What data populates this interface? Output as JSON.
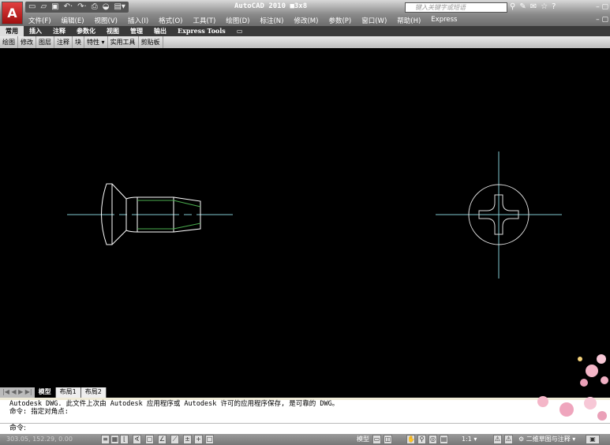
{
  "app": {
    "title": "AutoCAD 2010  ■3x8",
    "logo": "A"
  },
  "quick_access": [
    "new-icon",
    "open-icon",
    "save-icon",
    "undo-icon",
    "redo-icon",
    "plot-icon",
    "preview-icon",
    "workspace-icon"
  ],
  "search": {
    "placeholder": "键入关键字或短语"
  },
  "menu": [
    "文件(F)",
    "编辑(E)",
    "视图(V)",
    "插入(I)",
    "格式(O)",
    "工具(T)",
    "绘图(D)",
    "标注(N)",
    "修改(M)",
    "参数(P)",
    "窗口(W)",
    "帮助(H)",
    "Express"
  ],
  "ribbon_tabs": [
    "常用",
    "插入",
    "注释",
    "参数化",
    "视图",
    "管理",
    "输出",
    "Express Tools"
  ],
  "panels": [
    "绘图",
    "修改",
    "图层",
    "注释",
    "块",
    "特性 ▾",
    "实用工具",
    "剪贴板"
  ],
  "layout_tabs": [
    "模型",
    "布局1",
    "布局2"
  ],
  "command": {
    "history": [
      "Autodesk DWG.   此文件上次由 Autodesk 应用程序或 Autodesk 许可的应用程序保存, 是可靠的 DWG。",
      "命令: 指定对角点:"
    ],
    "prompt": "命令:"
  },
  "status": {
    "coords": "303.05, 152.29, 0.00",
    "model": "模型",
    "scale": "1:1 ▾",
    "workspace": "二维草图与注释 ▾"
  },
  "colors": {
    "outline": "#ffffff",
    "centerline": "#7fc8d0",
    "thread": "#4caf50",
    "background": "#000000"
  }
}
